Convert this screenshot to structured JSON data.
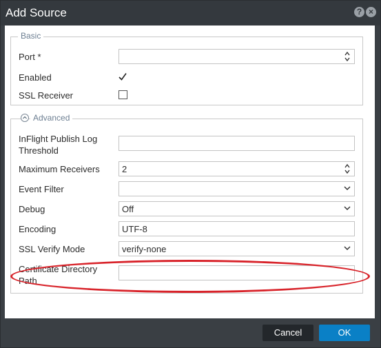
{
  "dialog": {
    "title": "Add Source"
  },
  "basic": {
    "legend": "Basic",
    "port_label": "Port *",
    "port_value": "",
    "enabled_label": "Enabled",
    "enabled_checked": true,
    "ssl_receiver_label": "SSL Receiver",
    "ssl_receiver_checked": false
  },
  "advanced": {
    "legend": "Advanced",
    "inflight_label_line1": "InFlight Publish Log",
    "inflight_label_line2": "Threshold",
    "inflight_value": "",
    "max_receivers_label": "Maximum Receivers",
    "max_receivers_value": "2",
    "event_filter_label": "Event Filter",
    "event_filter_value": "",
    "debug_label": "Debug",
    "debug_value": "Off",
    "encoding_label": "Encoding",
    "encoding_value": "UTF-8",
    "ssl_verify_label": "SSL Verify Mode",
    "ssl_verify_value": "verify-none",
    "cert_dir_label_line1": "Certificate Directory",
    "cert_dir_label_line2": "Path",
    "cert_dir_value": ""
  },
  "footer": {
    "cancel_label": "Cancel",
    "ok_label": "OK"
  },
  "icons": {
    "help": "help-icon",
    "close": "close-icon",
    "spinner": "spinner-icon",
    "dropdown": "chevron-down-icon",
    "collapse": "chevron-up-circle-icon"
  },
  "colors": {
    "titlebar": "#34393e",
    "ok_button": "#0a80c6",
    "cancel_button": "#23272b",
    "legend_text": "#6d7f92",
    "highlight": "#d8232a"
  }
}
